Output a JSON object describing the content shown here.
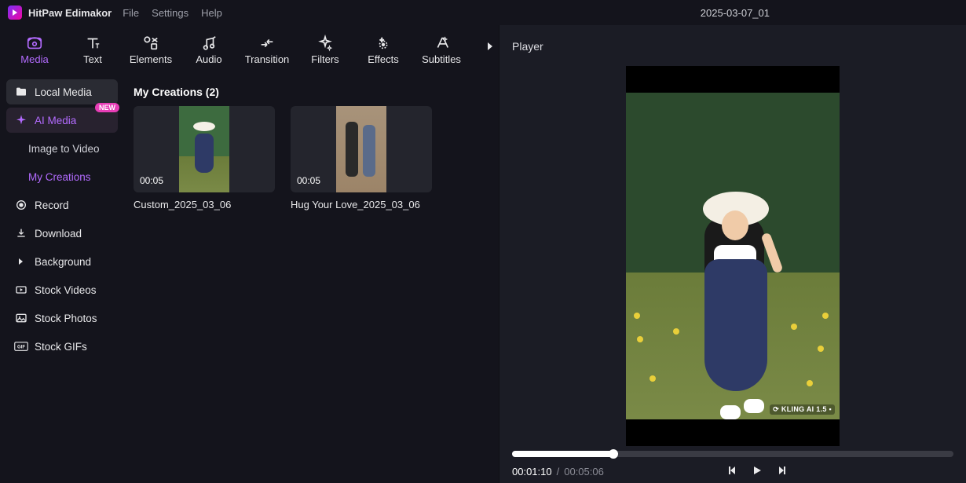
{
  "app": {
    "name": "HitPaw Edimakor",
    "project": "2025-03-07_01"
  },
  "menubar": {
    "file": "File",
    "settings": "Settings",
    "help": "Help"
  },
  "tool_tabs": {
    "media": "Media",
    "text": "Text",
    "elements": "Elements",
    "audio": "Audio",
    "transition": "Transition",
    "filters": "Filters",
    "effects": "Effects",
    "subtitles": "Subtitles"
  },
  "sidebar": {
    "local_media": "Local Media",
    "ai_media": "AI Media",
    "ai_media_badge": "NEW",
    "image_to_video": "Image to Video",
    "my_creations": "My Creations",
    "record": "Record",
    "download": "Download",
    "background": "Background",
    "stock_videos": "Stock Videos",
    "stock_photos": "Stock Photos",
    "stock_gifs": "Stock GIFs"
  },
  "content": {
    "section_title": "My Creations (2)",
    "items": [
      {
        "duration": "00:05",
        "name": "Custom_2025_03_06"
      },
      {
        "duration": "00:05",
        "name": "Hug Your Love_2025_03_06"
      }
    ]
  },
  "player": {
    "title": "Player",
    "current_time": "00:01:10",
    "total_time": "00:05:06",
    "time_sep": " / ",
    "progress_pct": 23,
    "watermark": "⟳ KLING AI 1.5 ▪"
  }
}
